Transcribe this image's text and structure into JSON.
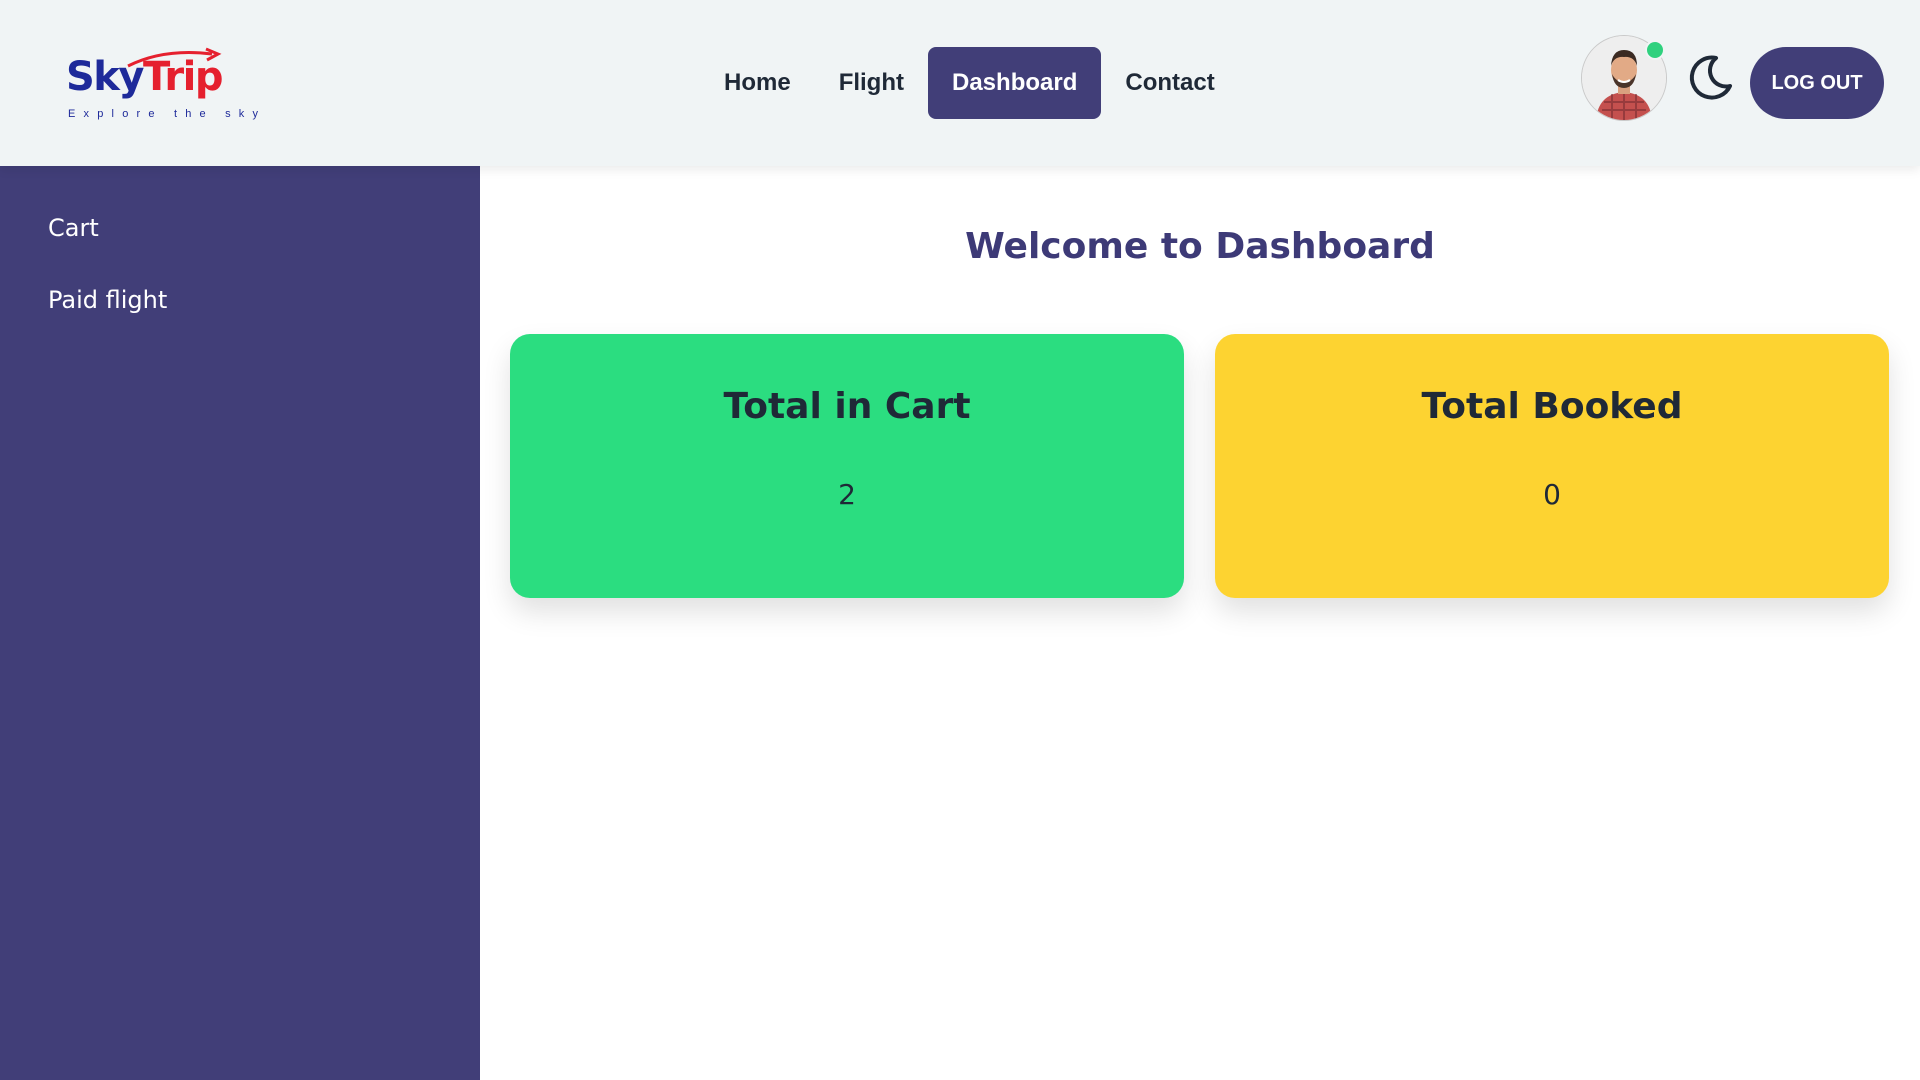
{
  "header": {
    "logo": {
      "sky": "Sky",
      "trip": "Trip",
      "tagline": "Explore the sky"
    },
    "nav": [
      {
        "label": "Home",
        "active": false
      },
      {
        "label": "Flight",
        "active": false
      },
      {
        "label": "Dashboard",
        "active": true
      },
      {
        "label": "Contact",
        "active": false
      }
    ],
    "avatar_icon": "user-avatar",
    "status_icon": "online-dot",
    "theme_icon": "moon-icon",
    "logout_label": "LOG OUT"
  },
  "sidebar": {
    "items": [
      {
        "label": "Cart"
      },
      {
        "label": "Paid flight"
      }
    ]
  },
  "main": {
    "title": "Welcome to Dashboard",
    "cards": [
      {
        "title": "Total in Cart",
        "value": "2",
        "color": "#2bdd80"
      },
      {
        "title": "Total Booked",
        "value": "0",
        "color": "#fdd331"
      }
    ]
  },
  "colors": {
    "accent": "#413e78",
    "header_bg": "#f0f4f5",
    "title": "#3d3a77",
    "online": "#2fd17e"
  }
}
